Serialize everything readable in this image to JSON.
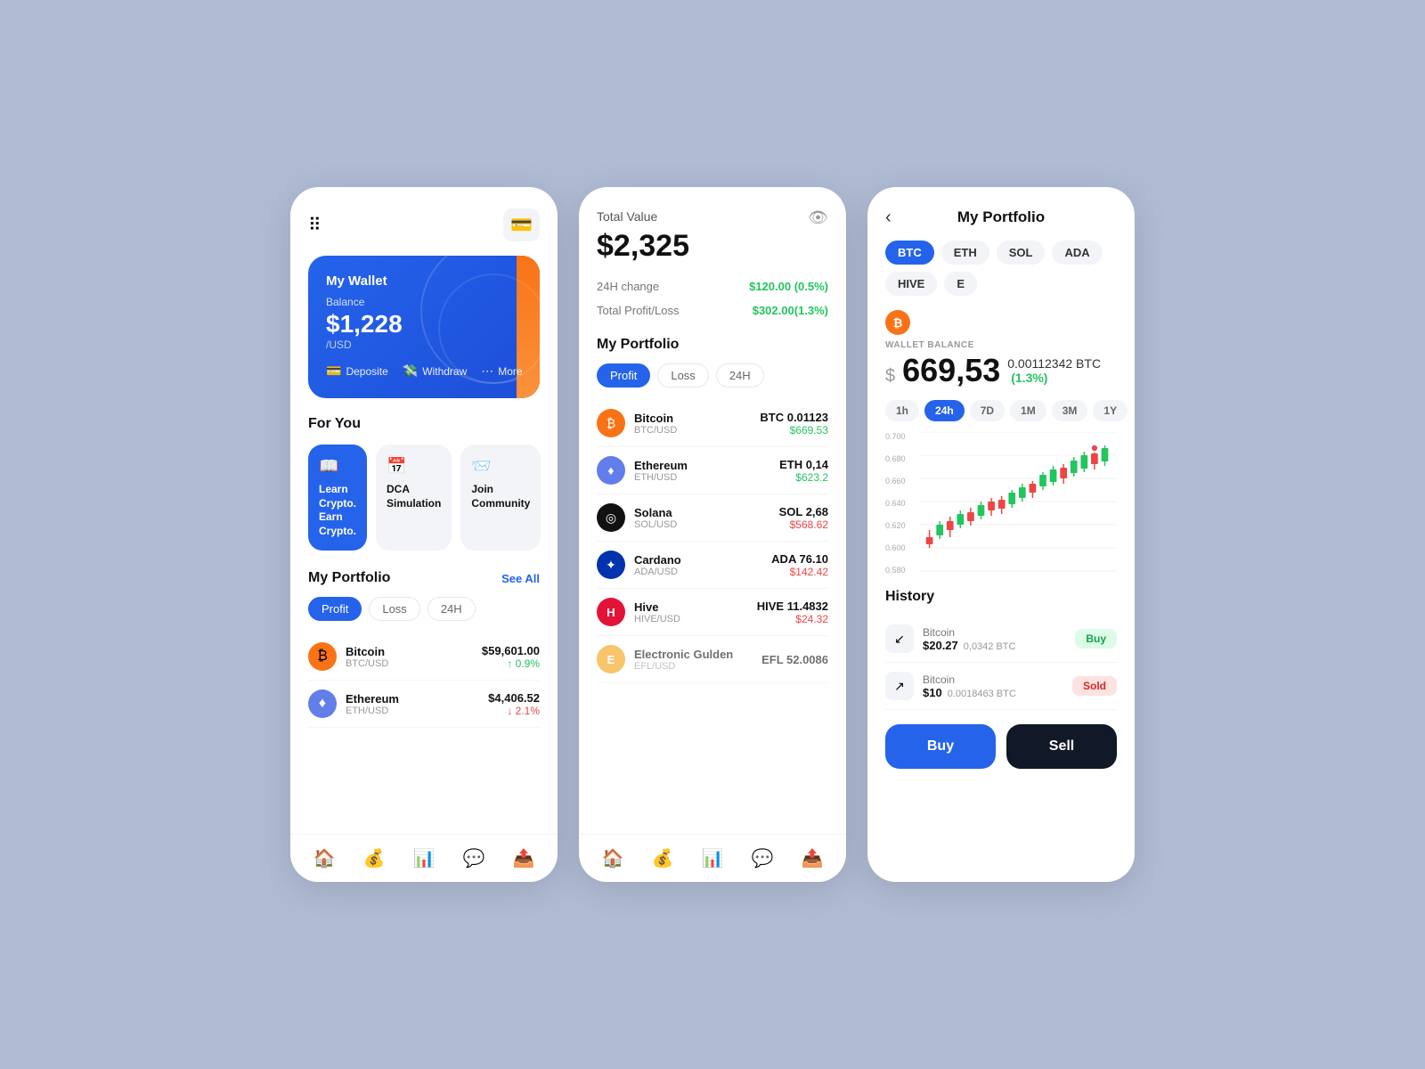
{
  "screen1": {
    "menu_icon": "⠿",
    "wallet_btn": "💳",
    "wallet_name": "My Wallet",
    "balance_label": "Balance",
    "balance_amount": "$1,228",
    "balance_currency": "/USD",
    "action_deposit": "Deposite",
    "action_withdraw": "Withdraw",
    "action_more": "More",
    "for_you_label": "For You",
    "cards": [
      {
        "icon": "📖",
        "label": "Learn Crypto. Earn Crypto.",
        "type": "blue"
      },
      {
        "icon": "📅",
        "label": "DCA Simulation",
        "type": "gray"
      },
      {
        "icon": "📨",
        "label": "Join Community",
        "type": "gray"
      }
    ],
    "portfolio_label": "My Portfolio",
    "see_all": "See All",
    "filters": [
      "Profit",
      "Loss",
      "24H"
    ],
    "active_filter": 0,
    "cryptos": [
      {
        "name": "Bitcoin",
        "pair": "BTC/USD",
        "price": "$59,601.00",
        "change": "↑ 0.9%",
        "up": true,
        "logo": "₿",
        "color": "btc"
      },
      {
        "name": "Ethereum",
        "pair": "ETH/USD",
        "price": "$4,406.52",
        "change": "↓ 2.1%",
        "up": false,
        "logo": "♦",
        "color": "eth"
      }
    ],
    "nav_icons": [
      "🏠",
      "💰",
      "📊",
      "💬",
      "📤"
    ],
    "active_nav": 0
  },
  "screen2": {
    "total_label": "Total Value",
    "total_value": "$2,325",
    "change_24h_label": "24H change",
    "change_24h_value": "$120.00 (0.5%)",
    "profit_loss_label": "Total Profit/Loss",
    "profit_loss_value": "$302.00(1.3%)",
    "portfolio_label": "My Portfolio",
    "filters": [
      "Profit",
      "Loss",
      "24H"
    ],
    "active_filter": 0,
    "cryptos": [
      {
        "name": "Bitcoin",
        "pair": "BTC/USD",
        "amount": "BTC 0.01123",
        "value": "$669.53",
        "up": true,
        "logo": "₿",
        "color": "btc"
      },
      {
        "name": "Ethereum",
        "pair": "ETH/USD",
        "amount": "ETH 0,14",
        "value": "$623.2",
        "up": true,
        "logo": "♦",
        "color": "eth"
      },
      {
        "name": "Solana",
        "pair": "SOL/USD",
        "amount": "SOL 2,68",
        "value": "$568.62",
        "up": false,
        "logo": "◎",
        "color": "sol"
      },
      {
        "name": "Cardano",
        "pair": "ADA/USD",
        "amount": "ADA 76.10",
        "value": "$142.42",
        "up": false,
        "logo": "✦",
        "color": "ada"
      },
      {
        "name": "Hive",
        "pair": "HIVE/USD",
        "amount": "HIVE 11.4832",
        "value": "$24.32",
        "up": false,
        "logo": "H",
        "color": "hive"
      },
      {
        "name": "Electronic Gulden",
        "pair": "EFL/USD",
        "amount": "EFL 52.0086",
        "value": "$...",
        "up": false,
        "logo": "E",
        "color": "elc"
      }
    ],
    "nav_icons": [
      "🏠",
      "💰",
      "📊",
      "💬",
      "📤"
    ],
    "active_nav": 1
  },
  "screen3": {
    "back": "‹",
    "title": "My Portfolio",
    "coin_tabs": [
      "BTC",
      "ETH",
      "SOL",
      "ADA",
      "HIVE",
      "E"
    ],
    "active_tab": 0,
    "btc_symbol": "₿",
    "wallet_balance_label": "WALLET BALANCE",
    "wallet_dollar": "$",
    "wallet_value": "669,53",
    "wallet_btc": "0.00112342 BTC",
    "wallet_change": "(1.3%)",
    "time_tabs": [
      "1h",
      "24h",
      "7D",
      "1M",
      "3M",
      "1Y"
    ],
    "active_time": 1,
    "y_labels": [
      "0.700",
      "0.680",
      "0.660",
      "0.640",
      "0.620",
      "0.600",
      "0.580"
    ],
    "history_title": "History",
    "history": [
      {
        "name": "Bitcoin",
        "amount": "$20.27",
        "qty": "0,0342 BTC",
        "badge": "Buy",
        "buy": true
      },
      {
        "name": "Bitcoin",
        "amount": "$10",
        "qty": "0.0018463 BTC",
        "badge": "Sold",
        "buy": false
      }
    ],
    "buy_label": "Buy",
    "sell_label": "Sell"
  }
}
